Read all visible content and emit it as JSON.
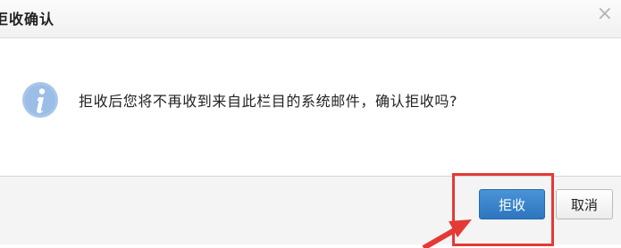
{
  "dialog": {
    "title": "拒收确认",
    "close_icon": "×",
    "message": "拒收后您将不再收到来自此栏目的系统邮件，确认拒收吗?",
    "info_icon": "info-icon",
    "buttons": {
      "confirm_label": "拒收",
      "cancel_label": "取消"
    }
  },
  "annotation": {
    "highlight_color": "#e53935"
  }
}
